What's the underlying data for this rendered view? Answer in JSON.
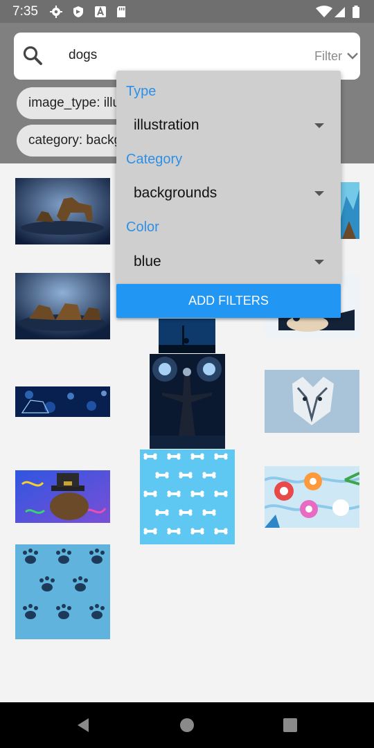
{
  "status_bar": {
    "time": "7:35",
    "icons": [
      "settings-icon",
      "shield-icon",
      "text-a-icon",
      "sd-card-icon",
      "wifi-icon",
      "signal-icon",
      "battery-icon"
    ]
  },
  "search": {
    "query": "dogs",
    "filter_label": "Filter"
  },
  "chips": [
    {
      "label": "image_type: illustration"
    },
    {
      "label": "category: backgrounds"
    }
  ],
  "filter_panel": {
    "type_label": "Type",
    "type_value": "illustration",
    "category_label": "Category",
    "category_value": "backgrounds",
    "color_label": "Color",
    "color_value": "blue",
    "add_button": "ADD FILTERS",
    "accent_color": "#2196f3"
  },
  "thumbnails": [
    {
      "name": "thumb-german-shepherds-rock",
      "column": 1
    },
    {
      "name": "thumb-german-shepherds-pups",
      "column": 1
    },
    {
      "name": "thumb-blue-bokeh-dogs",
      "column": 1
    },
    {
      "name": "thumb-pilgrim-hat-dog",
      "column": 1
    },
    {
      "name": "thumb-blue-paw-prints",
      "column": 1
    },
    {
      "name": "thumb-night-silhouette",
      "column": 2
    },
    {
      "name": "thumb-dark-gothic-figure",
      "column": 2
    },
    {
      "name": "thumb-dog-bones-pattern",
      "column": 2
    },
    {
      "name": "thumb-blue-mountains-partial",
      "column": 3
    },
    {
      "name": "thumb-puppy-ink",
      "column": 3
    },
    {
      "name": "thumb-wolf-snow",
      "column": 3
    },
    {
      "name": "thumb-pool-floaties",
      "column": 3
    }
  ],
  "nav_bar": {
    "buttons": [
      "back-icon",
      "home-icon",
      "recents-icon"
    ]
  }
}
